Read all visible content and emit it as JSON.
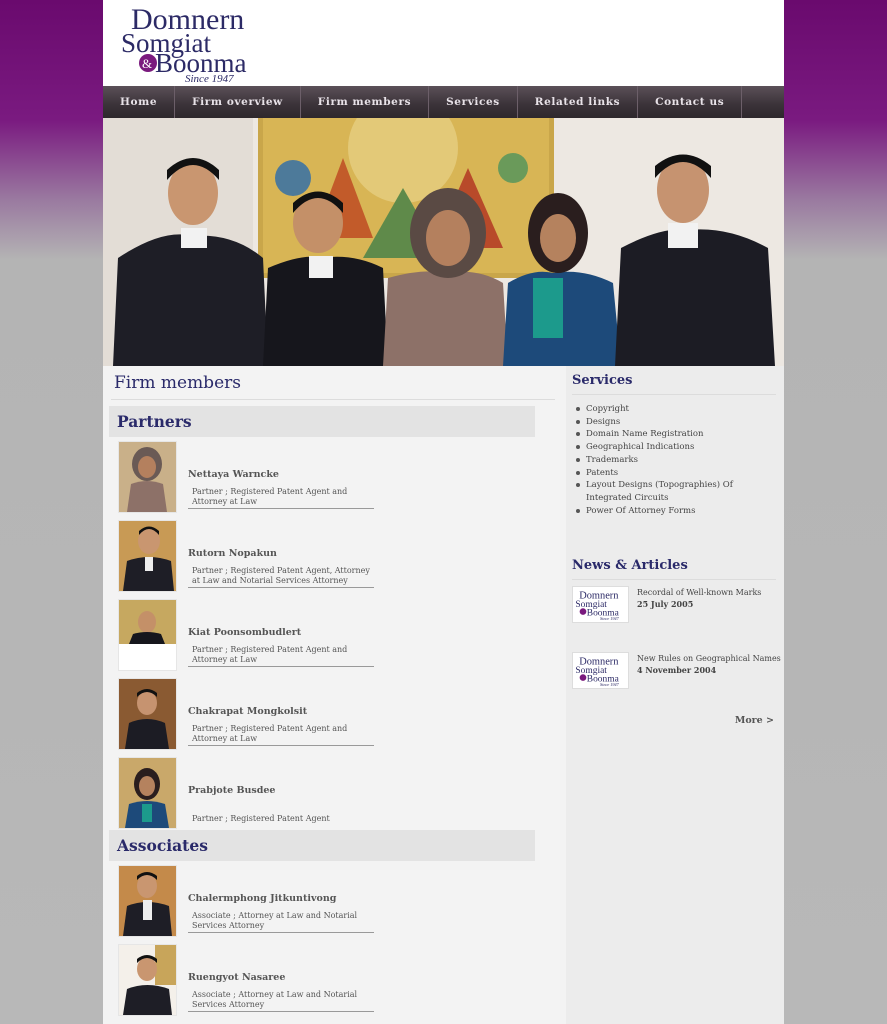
{
  "logo": {
    "line1": "Domnern",
    "line2": "Somgiat",
    "amp": "&",
    "line3": "Boonma",
    "since": "Since 1947"
  },
  "nav": [
    "Home",
    "Firm overview",
    "Firm members",
    "Services",
    "Related links",
    "Contact us"
  ],
  "main": {
    "title": "Firm members",
    "partners_heading": "Partners",
    "partners": [
      {
        "name": "Nettaya Warncke",
        "role": "Partner ; Registered Patent Agent and Attorney at Law"
      },
      {
        "name": "Rutorn Nopakun",
        "role": "Partner ; Registered Patent Agent, Attorney at Law and Notarial Services Attorney"
      },
      {
        "name": "Kiat Poonsombudlert",
        "role": "Partner ; Registered Patent Agent and Attorney at Law"
      },
      {
        "name": "Chakrapat Mongkolsit",
        "role": "Partner ; Registered Patent Agent and Attorney at Law"
      },
      {
        "name": "Prabjote Busdee",
        "role": "Partner ; Registered Patent Agent"
      }
    ],
    "associates_heading": "Associates",
    "associates": [
      {
        "name": "Chalermphong Jitkuntivong",
        "role": "Associate ; Attorney at Law and Notarial Services Attorney"
      },
      {
        "name": "Ruengyot Nasaree",
        "role": "Associate ; Attorney at Law and Notarial Services Attorney"
      }
    ]
  },
  "side": {
    "services_heading": "Services",
    "services": [
      "Copyright",
      "Designs",
      "Domain Name Registration",
      "Geographical Indications",
      " Trademarks",
      "Patents",
      "Layout Designs (Topographies) Of Integrated Circuits",
      "Power Of Attorney Forms"
    ],
    "news_heading": "News & Articles",
    "news": [
      {
        "title": "Recordal of Well-known Marks",
        "date": "25 July 2005"
      },
      {
        "title": "New Rules on Geographical Names",
        "date": "4 November 2004"
      }
    ],
    "more": "More >"
  },
  "colors": {
    "brand_purple": "#6a0a6e",
    "heading_navy": "#2a2a6a"
  }
}
